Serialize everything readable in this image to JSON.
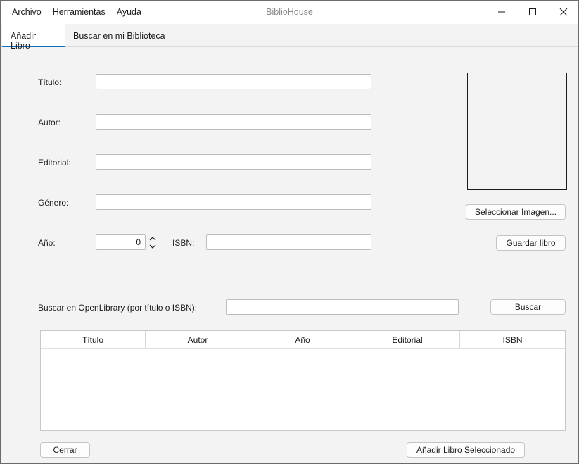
{
  "window": {
    "title": "BiblioHouse",
    "menu": [
      "Archivo",
      "Herramientas",
      "Ayuda"
    ]
  },
  "tabs": [
    {
      "label": "Añadir Libro",
      "active": true
    },
    {
      "label": "Buscar en mi Biblioteca",
      "active": false
    }
  ],
  "form": {
    "titulo_label": "Título:",
    "titulo_value": "",
    "autor_label": "Autor:",
    "autor_value": "",
    "editorial_label": "Editorial:",
    "editorial_value": "",
    "genero_label": "Género:",
    "genero_value": "",
    "anio_label": "Año:",
    "anio_value": "0",
    "isbn_label": "ISBN:",
    "isbn_value": "",
    "select_image_label": "Seleccionar Imagen...",
    "save_label": "Guardar libro"
  },
  "search": {
    "label": "Buscar en OpenLibrary (por título o ISBN):",
    "value": "",
    "button_label": "Buscar"
  },
  "results": {
    "columns": [
      "Título",
      "Autor",
      "Año",
      "Editorial",
      "ISBN"
    ],
    "rows": []
  },
  "footer": {
    "close_label": "Cerrar",
    "add_selected_label": "Añadir Libro Seleccionado"
  },
  "colors": {
    "accent": "#0f6cbd"
  }
}
